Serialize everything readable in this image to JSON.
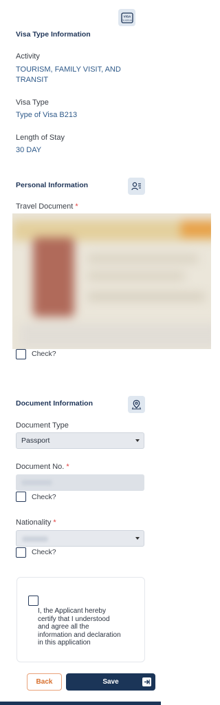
{
  "top_icon": {
    "icon": "visa-card-icon",
    "text_top": "VISA",
    "text_bottom": "ON ARRIVAL"
  },
  "visa_type": {
    "title": "Visa Type Information",
    "activity_label": "Activity",
    "activity_value_line1": "TOURISM, FAMILY VISIT, AND",
    "activity_value_line2": "TRANSIT",
    "visa_type_label": "Visa Type",
    "visa_type_value": "Type of Visa B213",
    "stay_label": "Length of Stay",
    "stay_value": "30 DAY"
  },
  "personal": {
    "title": "Personal Information",
    "icon": "person-list-icon",
    "travel_doc_label": "Travel Document",
    "required_mark": "*",
    "check_label": "Check?"
  },
  "document": {
    "title": "Document Information",
    "icon": "location-pin-icon",
    "doc_type_label": "Document Type",
    "doc_type_value": "Passport",
    "doc_no_label": "Document No.",
    "required_mark": "*",
    "doc_no_check_label": "Check?",
    "nationality_label": "Nationality",
    "nationality_check_label": "Check?"
  },
  "declaration": {
    "line1": "I, the Applicant hereby",
    "line2": "certify that I understood",
    "line3": "and agree all the",
    "line4": "information and declaration",
    "line5": "in this application"
  },
  "actions": {
    "back_label": "Back",
    "save_label": "Save"
  },
  "colors": {
    "primary": "#1b3558",
    "accent": "#d8702e",
    "required": "#e0403f",
    "value_text": "#2f5a8a"
  }
}
